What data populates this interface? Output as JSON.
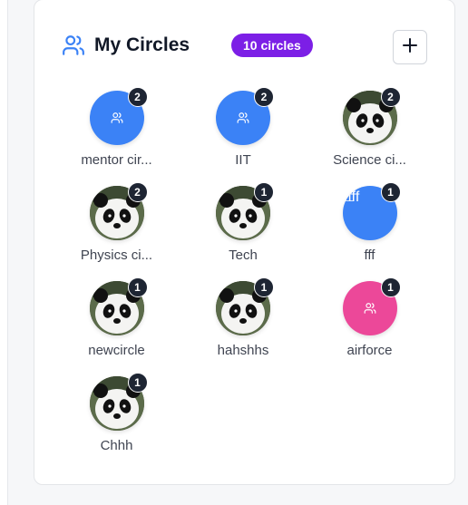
{
  "header": {
    "title": "My Circles",
    "count_badge": "10 circles",
    "add_button_icon": "plus-icon",
    "title_icon": "users-icon"
  },
  "colors": {
    "accent_blue": "#3b82f6",
    "badge_purple": "#7c1fe6",
    "pink": "#ec4899",
    "count_badge_dark": "#1e2533"
  },
  "circles": [
    {
      "name": "mentor cir...",
      "members": "2",
      "avatar": "blue-users-icon"
    },
    {
      "name": "IIT",
      "members": "2",
      "avatar": "blue-users-icon"
    },
    {
      "name": "Science ci...",
      "members": "2",
      "avatar": "panda-photo"
    },
    {
      "name": "Physics ci...",
      "members": "2",
      "avatar": "panda-photo"
    },
    {
      "name": "Tech",
      "members": "1",
      "avatar": "panda-photo"
    },
    {
      "name": "fff",
      "members": "1",
      "avatar": "broken-image",
      "alt": "fff"
    },
    {
      "name": "newcircle",
      "members": "1",
      "avatar": "panda-photo"
    },
    {
      "name": "hahshhs",
      "members": "1",
      "avatar": "panda-photo"
    },
    {
      "name": "airforce",
      "members": "1",
      "avatar": "pink-users-icon"
    },
    {
      "name": "Chhh",
      "members": "1",
      "avatar": "panda-photo"
    }
  ]
}
